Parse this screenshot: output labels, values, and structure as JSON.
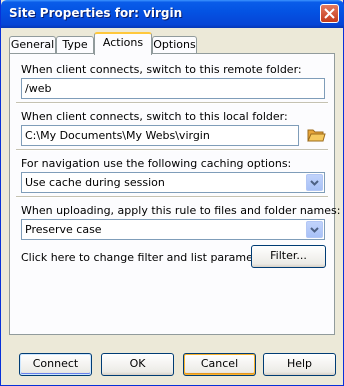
{
  "window": {
    "title": "Site Properties for: virgin"
  },
  "tabs": [
    {
      "label": "General"
    },
    {
      "label": "Type"
    },
    {
      "label": "Actions"
    },
    {
      "label": "Options"
    }
  ],
  "active_tab": "Actions",
  "remote_folder": {
    "label": "When client connects, switch to this remote folder:",
    "value": "/web"
  },
  "local_folder": {
    "label": "When client connects, switch to this local folder:",
    "value": "C:\\My Documents\\My Webs\\virgin",
    "browse_icon": "folder-open-icon"
  },
  "caching": {
    "label": "For navigation use the following caching options:",
    "value": "Use cache during session"
  },
  "upload_rule": {
    "label": "When uploading, apply this rule to files and folder names:",
    "value": "Preserve case"
  },
  "filter": {
    "label": "Click here to change filter and list parameters:",
    "button": "Filter..."
  },
  "buttons": {
    "connect": "Connect",
    "ok": "OK",
    "cancel": "Cancel",
    "help": "Help"
  },
  "colors": {
    "titlebar": "#0453e3",
    "dialog_bg": "#ece9d8",
    "panel_bg": "#fcfcfe",
    "active_tab_accent": "#ffc83c"
  }
}
